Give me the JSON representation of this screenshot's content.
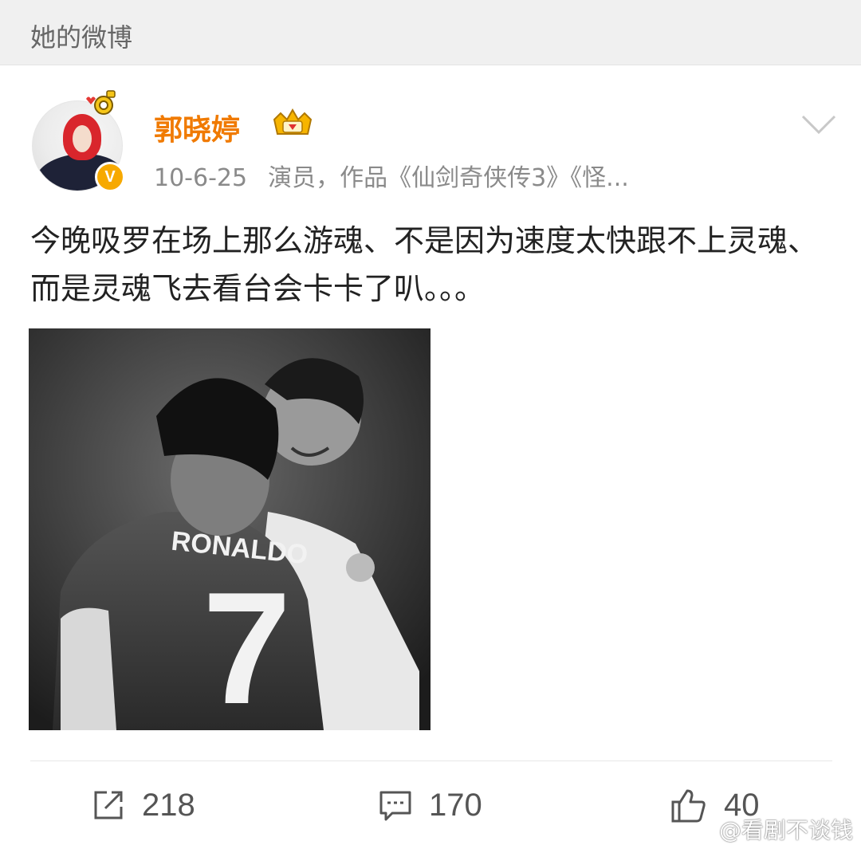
{
  "section": {
    "title": "她的微博"
  },
  "user": {
    "name": "郭晓婷",
    "verified_mark": "V"
  },
  "post": {
    "time": "10-6-25",
    "description": "演员，作品《仙剑奇侠传3》《怪...",
    "text": "今晚吸罗在场上那么游魂、不是因为速度太快跟不上灵魂、而是灵魂飞去看台会卡卡了叭。。。",
    "photo": {
      "jersey_name": "RONALDO",
      "jersey_number": "7"
    }
  },
  "actions": {
    "repost_count": "218",
    "comment_count": "170",
    "like_count": "40"
  },
  "watermark": {
    "text": "@看剧不谈钱"
  },
  "colors": {
    "username": "#f07a00",
    "verified": "#f7a900",
    "header_bg": "#f0f0f0"
  },
  "icons": [
    "chevron-down-icon",
    "crown-badge-icon",
    "repost-icon",
    "comment-icon",
    "like-icon",
    "weibo-logo-icon"
  ]
}
